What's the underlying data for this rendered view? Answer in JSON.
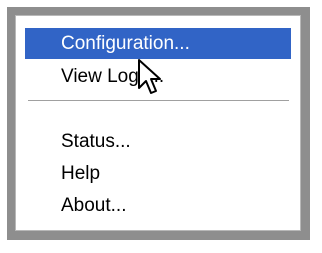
{
  "menu": {
    "items": [
      {
        "label": "Configuration..."
      },
      {
        "label": "View Logs..."
      },
      {
        "label": "Status..."
      },
      {
        "label": "Help"
      },
      {
        "label": "About..."
      }
    ],
    "highlighted_item": "Configuration...",
    "highlight_color": "#3164c6",
    "cursor_icon": "arrow-pointer-icon"
  }
}
